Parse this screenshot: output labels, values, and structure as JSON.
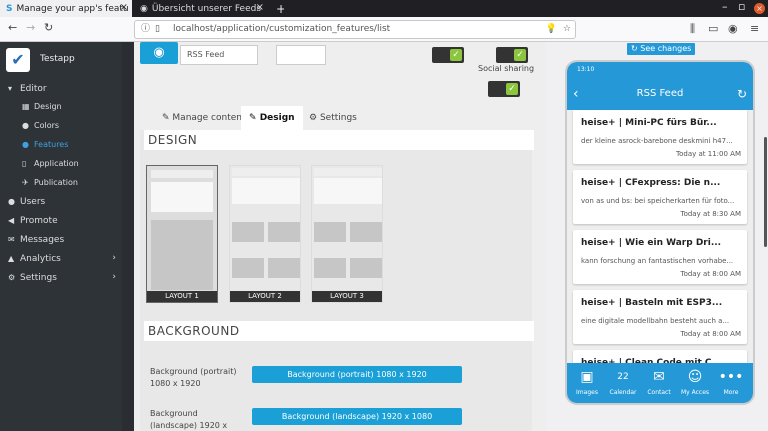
{
  "browser": {
    "tab1_title": "Manage your app's featu",
    "tab2_title": "Übersicht unserer Feeds",
    "new_tab": "+",
    "url": "localhost/application/customization_features/list"
  },
  "sidebar": {
    "app_name": "Testapp",
    "items": [
      {
        "label": "Editor",
        "icon": "▾"
      },
      {
        "label": "Design",
        "icon": "▦"
      },
      {
        "label": "Colors",
        "icon": "●"
      },
      {
        "label": "Features",
        "icon": "●"
      },
      {
        "label": "Application",
        "icon": "▯"
      },
      {
        "label": "Publication",
        "icon": "✈"
      },
      {
        "label": "Users",
        "icon": "●"
      },
      {
        "label": "Promote",
        "icon": "◀"
      },
      {
        "label": "Messages",
        "icon": "✉"
      },
      {
        "label": "Analytics",
        "icon": "▲"
      },
      {
        "label": "Settings",
        "icon": "⚙"
      }
    ]
  },
  "feature": {
    "name": "RSS Feed",
    "social_sharing": "Social sharing"
  },
  "tabs": {
    "manage": "Manage content",
    "design": "Design",
    "settings": "Settings"
  },
  "design": {
    "heading": "DESIGN",
    "layouts": [
      "LAYOUT 1",
      "LAYOUT 2",
      "LAYOUT 3"
    ]
  },
  "background": {
    "heading": "BACKGROUND",
    "portrait_label": "Background (portrait) 1080 x 1920",
    "portrait_button": "Background (portrait) 1080 x 1920",
    "landscape_label": "Background (landscape) 1920 x",
    "landscape_button": "Background (landscape) 1920 x 1080"
  },
  "preview": {
    "see_changes": "See changes",
    "time": "13:10",
    "title": "RSS Feed",
    "items": [
      {
        "title": "heise+ | Mini-PC fürs Bür...",
        "desc": "der kleine asrock-barebone deskmini h47...",
        "time": "Today at 11:00 AM"
      },
      {
        "title": "heise+ | CFexpress: Die n...",
        "desc": "von as und bs: bei speicherkarten für foto...",
        "time": "Today at 8:30 AM"
      },
      {
        "title": "heise+ | Wie ein Warp Dri...",
        "desc": "kann forschung an fantastischen vorhabe...",
        "time": "Today at 8:00 AM"
      },
      {
        "title": "heise+ | Basteln mit ESP3...",
        "desc": "eine digitale modellbahn besteht auch a...",
        "time": "Today at 8:00 AM"
      },
      {
        "title": "heise+ | Clean Code mit C...",
        "desc": "",
        "time": ""
      }
    ],
    "footer": [
      {
        "label": "Images",
        "icon": "▣"
      },
      {
        "label": "Calendar",
        "icon": "22"
      },
      {
        "label": "Contact",
        "icon": "✉"
      },
      {
        "label": "My Acces",
        "icon": "☺"
      },
      {
        "label": "More",
        "icon": "•••"
      }
    ]
  },
  "colors": {
    "accent": "#2599d8",
    "sidebar": "#2e3338",
    "toggle_on": "#8cc63f"
  }
}
